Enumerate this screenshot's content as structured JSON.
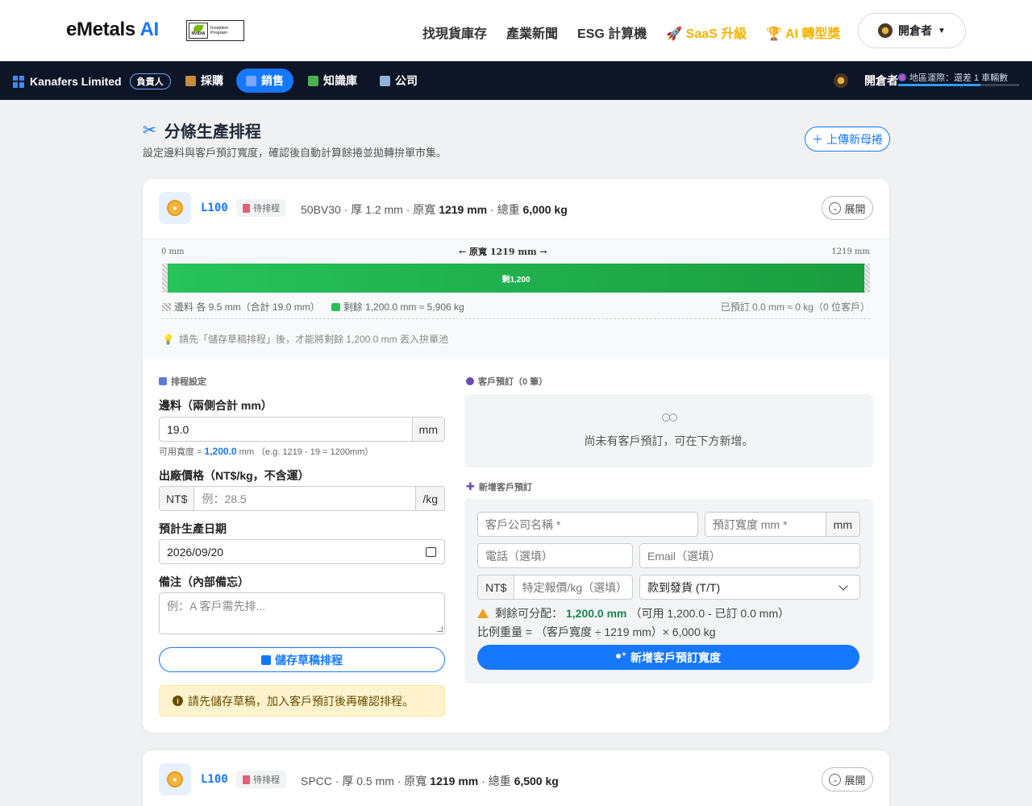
{
  "header": {
    "logo_main": "eMetals",
    "logo_ai": "AI",
    "badge_brand": "NVIDIA",
    "badge_line1": "Inception",
    "badge_line2": "Program",
    "nav": [
      "找現貨庫存",
      "產業新聞",
      "ESG 計算機"
    ],
    "nav_saas": "SaaS 升級",
    "nav_award": "AI 轉型獎",
    "user": "開倉者"
  },
  "subnav": {
    "org": "Kanafers Limited",
    "role": "負責人",
    "tabs": [
      "採購",
      "銷售",
      "知識庫",
      "公司"
    ],
    "active_tab": "銷售",
    "user": "開倉者",
    "region": "地區運際：還差 1 車輛數",
    "region_progress": 0.68
  },
  "page": {
    "title": "分條生產排程",
    "subtitle": "設定邊料與客戶預訂寬度，確認後自動計算餘捲並拋轉拚單市集。",
    "upload_button": "上傳新母捲"
  },
  "coils": [
    {
      "code": "L100",
      "status": "待排程",
      "material": "50BV30",
      "thickness_label": "厚 1.2 mm",
      "width_prefix": "原寬",
      "width": "1219 mm",
      "weight_prefix": "總重",
      "weight": "6,000 kg",
      "expand": "展開"
    },
    {
      "code": "L100",
      "status": "待排程",
      "material": "SPCC",
      "thickness_label": "厚 0.5 mm",
      "width_prefix": "原寬",
      "width": "1219 mm",
      "weight_prefix": "總重",
      "weight": "6,500 kg",
      "expand": "展開"
    }
  ],
  "width_panel": {
    "left_mark": "0 mm",
    "right_mark": "1219 mm",
    "center_label": "← 原寬 1219 mm →",
    "bar_label": "剩1,200",
    "legend_trim": "邊料 各 9.5 mm（合計 19.0 mm）",
    "legend_remaining": "剩餘 1,200.0 mm ≈ 5,906 kg",
    "reserved_summary": "已預訂 0.0 mm ≈ 0 kg（0 位客戶）",
    "tip": "請先「儲存草稿排程」後，才能將剩餘 1,200.0 mm 丟入拚單池"
  },
  "schedule_form": {
    "section_title": "排程設定",
    "trim_label": "邊料（兩側合計 mm）",
    "trim_value": "19.0",
    "trim_unit": "mm",
    "usable_prefix": "可用寬度 =",
    "usable_value": "1,200.0",
    "usable_suffix": "mm （e.g. 1219 - 19 = 1200mm）",
    "price_label": "出廠價格（NT$/kg，不含運）",
    "price_prefix": "NT$",
    "price_placeholder": "例：28.5",
    "price_unit": "/kg",
    "date_label": "預計生產日期",
    "date_value": "2026/09/20",
    "note_label": "備注（內部備忘）",
    "note_placeholder": "例：A 客戶需先排...",
    "save_button": "儲存草稿排程",
    "warning": "請先儲存草稿，加入客戶預訂後再確認排程。"
  },
  "reservations": {
    "section_title": "客戶預訂（0 筆）",
    "empty_text": "尚未有客戶預訂，可在下方新增。"
  },
  "new_reservation": {
    "section_title": "新增客戶預訂",
    "company_placeholder": "客戶公司名稱 *",
    "width_placeholder": "預訂寬度 mm *",
    "width_unit": "mm",
    "phone_placeholder": "電話（選填）",
    "email_placeholder": "Email（選填）",
    "price_prefix": "NT$",
    "price_placeholder": "特定報價/kg（選填）",
    "payment_selected": "款到發貨 (T/T)",
    "alloc_prefix": "剩餘可分配：",
    "alloc_value": "1,200.0 mm",
    "alloc_detail": "（可用 1,200.0 - 已訂 0.0 mm）",
    "ratio_text": "比例重量 = （客戶寬度 ÷ 1219 mm）× 6,000 kg",
    "add_button": "新增客戶預訂寬度"
  },
  "colors": {
    "accent": "#1677ff",
    "remaining_bar": "#27c25a",
    "warning_bg": "#fff3cd",
    "subnav_bg": "#0d1526"
  }
}
